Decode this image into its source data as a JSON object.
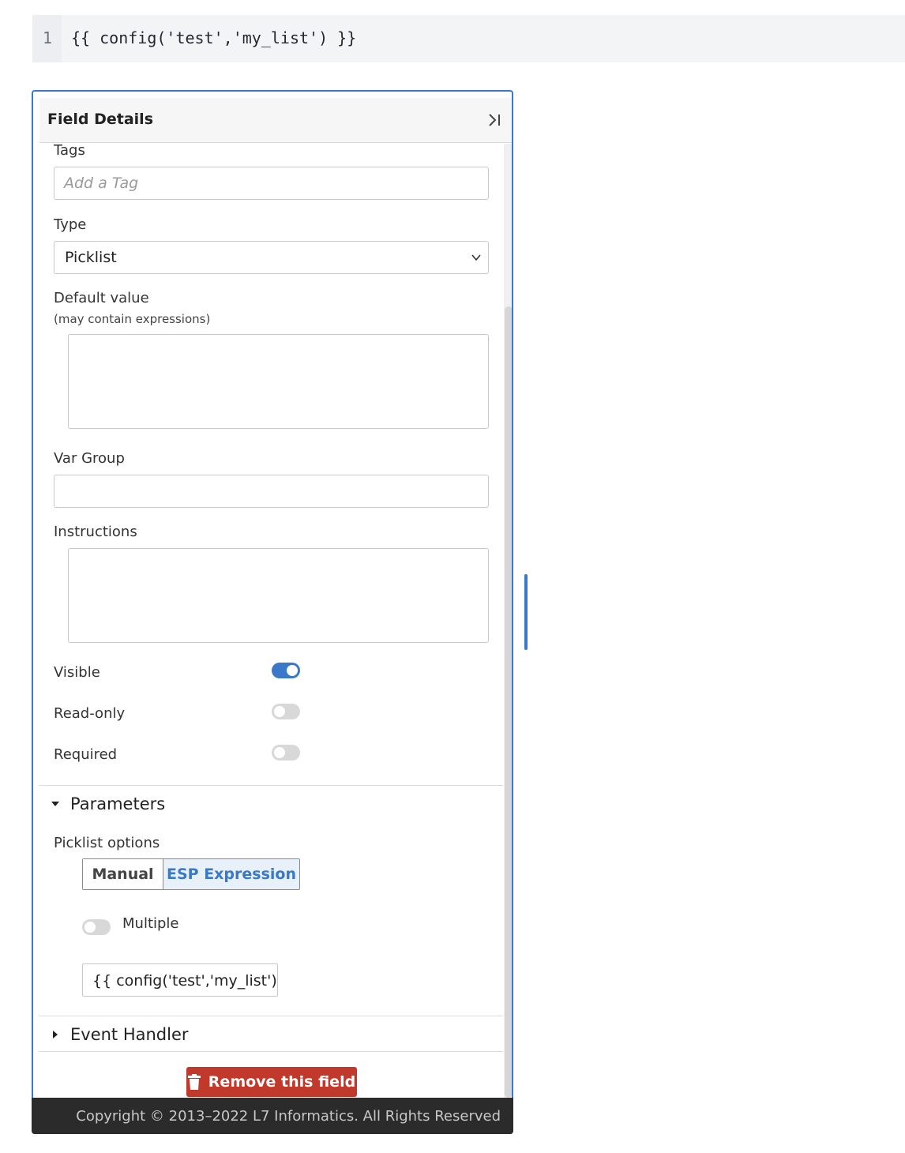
{
  "code": {
    "line_number": "1",
    "line_text": "{{ config('test','my_list') }}"
  },
  "panel": {
    "title": "Field Details",
    "collapse_icon": "collapse-right-icon"
  },
  "tags": {
    "label": "Tags",
    "placeholder": "Add a Tag"
  },
  "type": {
    "label": "Type",
    "value": "Picklist"
  },
  "default_value": {
    "label": "Default value",
    "sublabel": "(may contain expressions)",
    "value": ""
  },
  "var_group": {
    "label": "Var Group",
    "value": ""
  },
  "instructions": {
    "label": "Instructions",
    "value": ""
  },
  "toggles": {
    "visible": {
      "label": "Visible",
      "on": true
    },
    "read_only": {
      "label": "Read-only",
      "on": false
    },
    "required": {
      "label": "Required",
      "on": false
    }
  },
  "parameters": {
    "title": "Parameters",
    "expanded": true,
    "picklist_options_label": "Picklist options",
    "segments": [
      "Manual",
      "ESP Expression"
    ],
    "selected_segment": "ESP Expression",
    "multiple_label": "Multiple",
    "multiple_on": false,
    "expression_value": "{{ config('test','my_list') }}"
  },
  "event_handler": {
    "title": "Event Handler",
    "expanded": false
  },
  "remove_button": {
    "label": "Remove this field",
    "icon": "trash-icon"
  },
  "footer": {
    "copyright": "Copyright © 2013–2022 L7 Informatics. All Rights Reserved"
  },
  "colors": {
    "accent": "#3a78c9",
    "danger": "#c0392b",
    "footer_bg": "#2b2b2b"
  }
}
